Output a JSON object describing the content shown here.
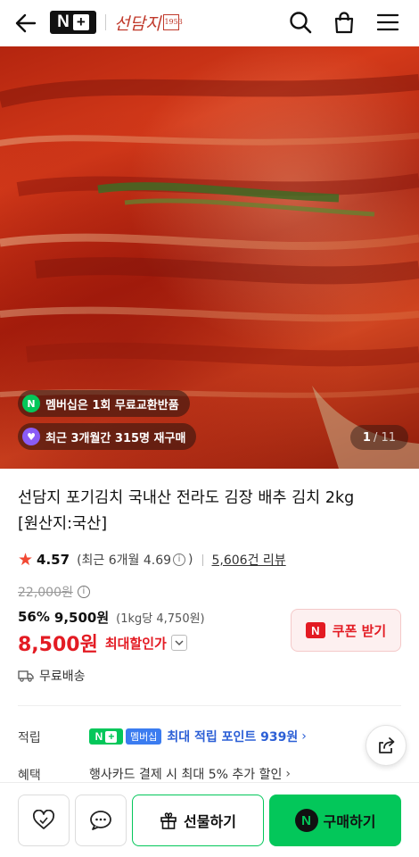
{
  "header": {
    "nplus_logo": "N+",
    "brand_name": "선담지",
    "brand_stamp": "1953"
  },
  "hero": {
    "badges": [
      {
        "text": "멤버십은 1회 무료교환반품",
        "icon_label": "N",
        "icon_color": "#03c75a"
      },
      {
        "text": "최근 3개월간 315명 재구매",
        "icon_label": "♥",
        "icon_color": "#8a5cf5"
      }
    ],
    "counter": {
      "current": "1",
      "total": "/ 11"
    }
  },
  "product": {
    "title_line1": "선담지 포기김치 국내산 전라도 김장 배추 김치 2kg",
    "title_line2": "[원산지:국산]",
    "rating": "4.57",
    "rating_recent": "(최근 6개월 4.69",
    "rating_recent_close": ")",
    "reviews": "5,606건 리뷰",
    "original_price": "22,000원",
    "discount_pct": "56%",
    "discount_price": "9,500원",
    "unit_price": "(1kg당 4,750원)",
    "final_price": "8,500원",
    "final_label": "최대할인가",
    "coupon_label": "쿠폰 받기",
    "shipping": "무료배송"
  },
  "details": {
    "points_label": "적립",
    "membership_chip": "멤버십",
    "points_text": "최대 적립 포인트 939원",
    "benefit_label": "혜택",
    "benefit_text": "행사카드 결제 시 최대 5% 추가 할인"
  },
  "bottom_bar": {
    "gift_label": "선물하기",
    "buy_label": "구매하기"
  },
  "colors": {
    "accent_green": "#03c75a",
    "sale_red": "#e31b23",
    "points_blue": "#2c5fd6"
  }
}
